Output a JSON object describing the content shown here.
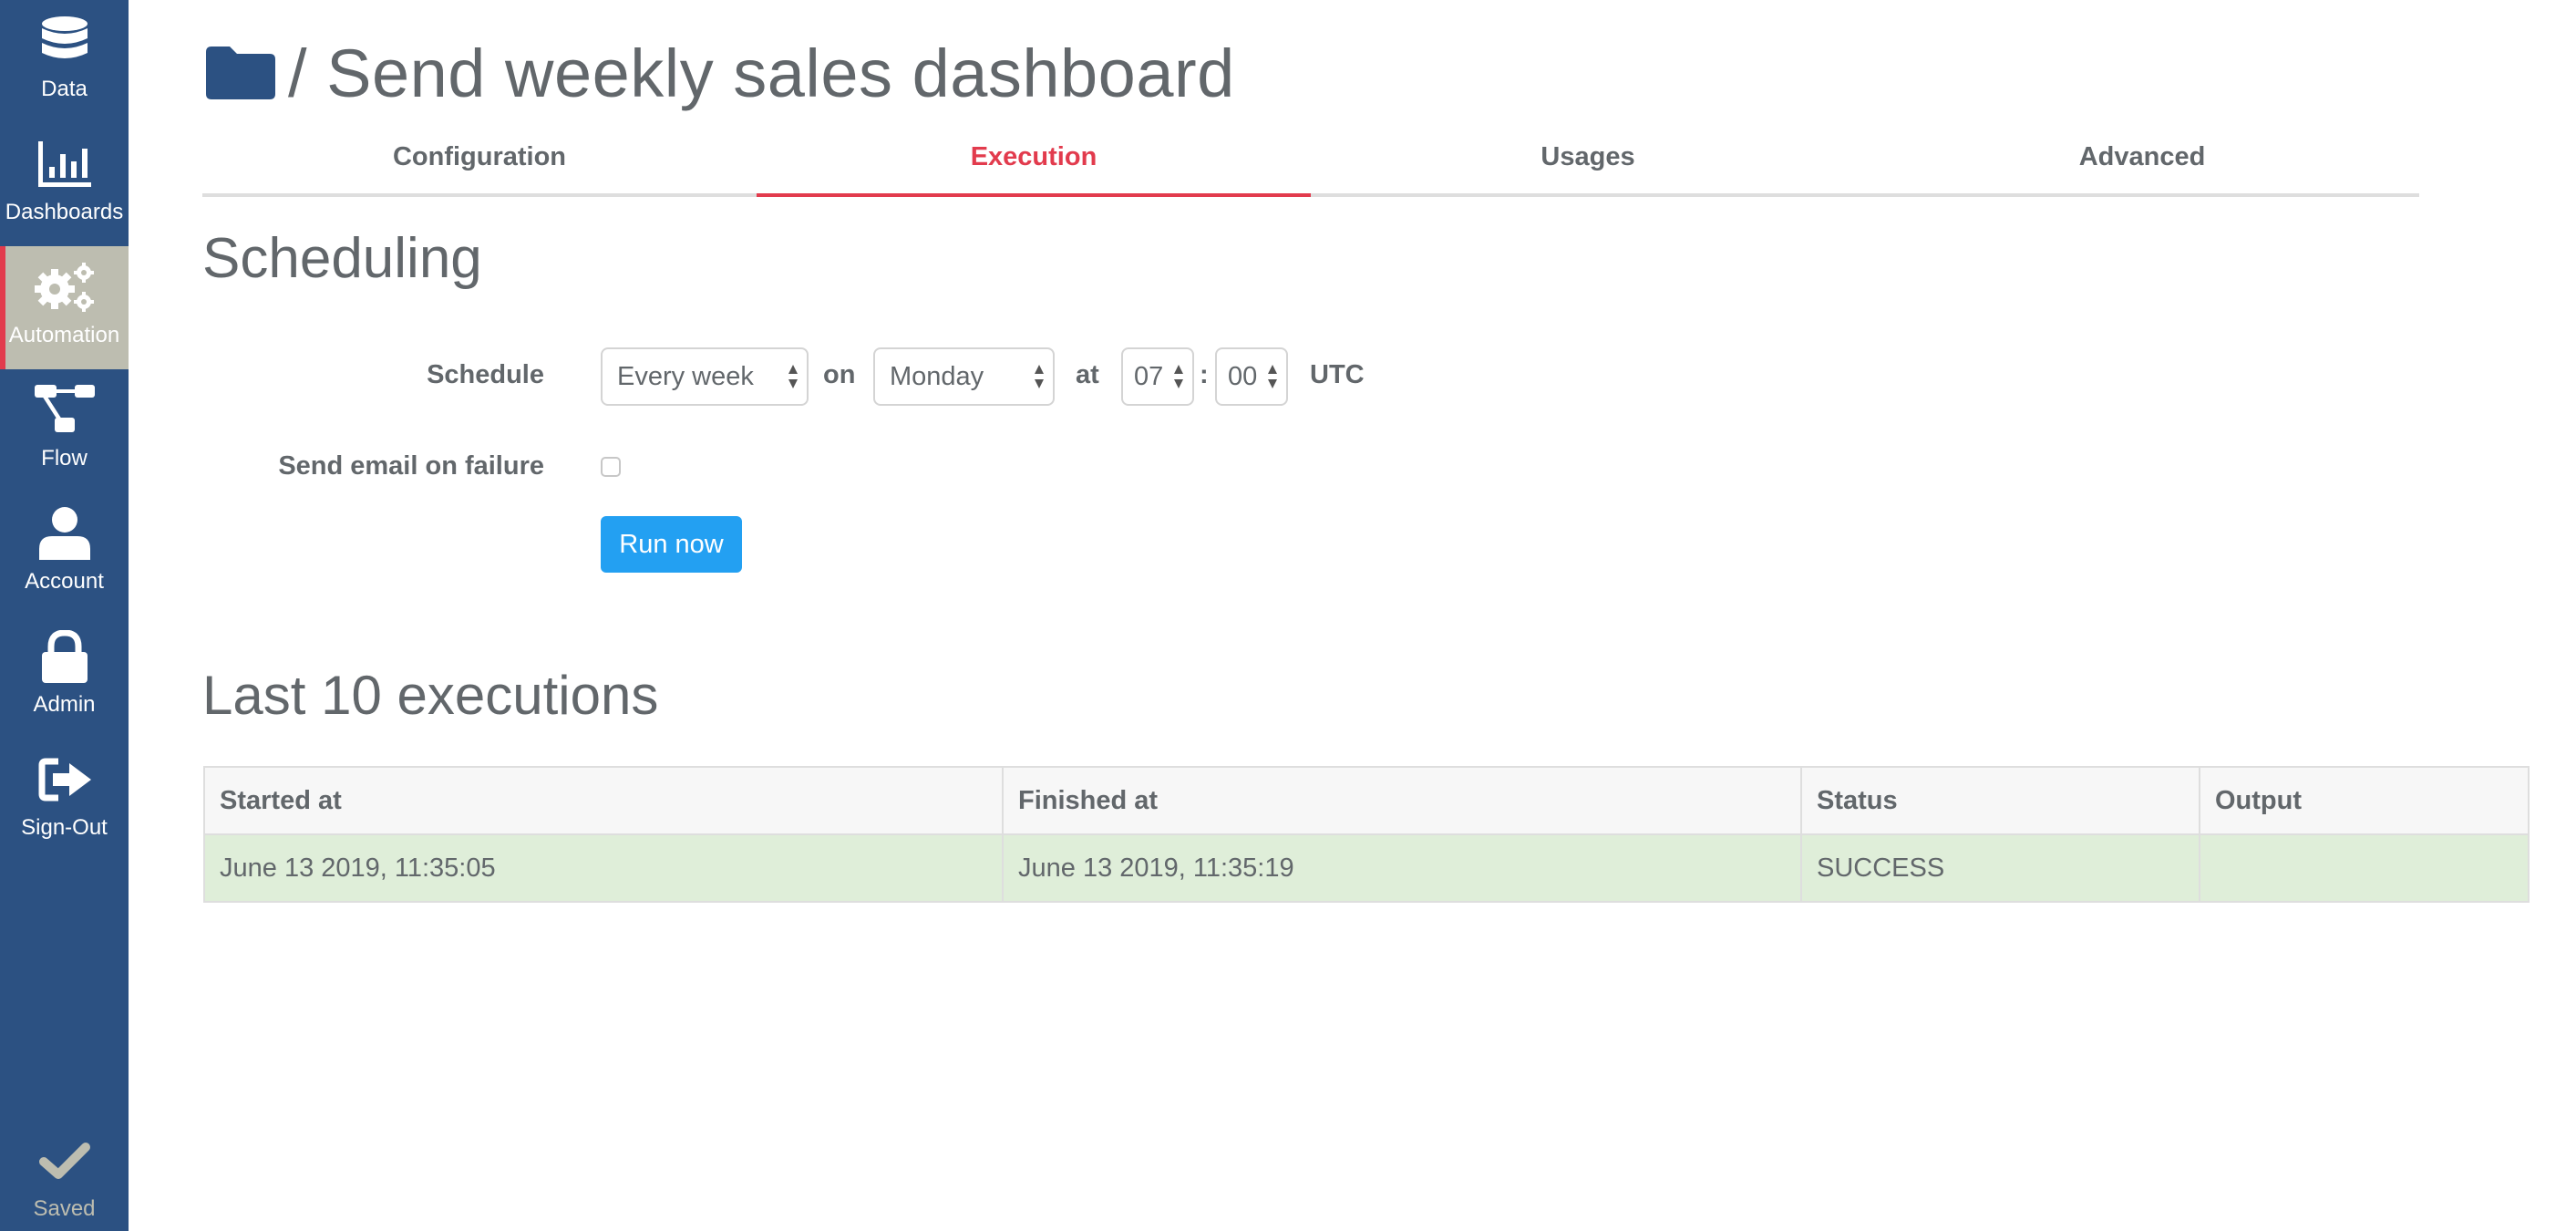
{
  "sidebar": {
    "items": [
      {
        "label": "Data",
        "icon": "database-icon",
        "active": false
      },
      {
        "label": "Dashboards",
        "icon": "bar-chart-icon",
        "active": false
      },
      {
        "label": "Automation",
        "icon": "gears-icon",
        "active": true
      },
      {
        "label": "Flow",
        "icon": "flow-icon",
        "active": false
      },
      {
        "label": "Account",
        "icon": "user-icon",
        "active": false
      },
      {
        "label": "Admin",
        "icon": "lock-icon",
        "active": false
      },
      {
        "label": "Sign-Out",
        "icon": "sign-out-icon",
        "active": false
      }
    ],
    "status": {
      "label": "Saved",
      "icon": "check-icon"
    }
  },
  "header": {
    "breadcrumb_icon": "folder-icon",
    "title": "/ Send weekly sales dashboard"
  },
  "tabs": [
    {
      "label": "Configuration",
      "active": false
    },
    {
      "label": "Execution",
      "active": true
    },
    {
      "label": "Usages",
      "active": false
    },
    {
      "label": "Advanced",
      "active": false
    }
  ],
  "scheduling": {
    "heading": "Scheduling",
    "schedule_label": "Schedule",
    "frequency": "Every week",
    "on_label": "on",
    "day": "Monday",
    "at_label": "at",
    "hour": "07",
    "time_separator": ":",
    "minute": "00",
    "timezone": "UTC",
    "email_label": "Send email on failure",
    "email_checked": false,
    "run_button": "Run now"
  },
  "executions": {
    "heading": "Last 10 executions",
    "columns": [
      "Started at",
      "Finished at",
      "Status",
      "Output"
    ],
    "rows": [
      {
        "started": "June 13 2019, 11:35:05",
        "finished": "June 13 2019, 11:35:19",
        "status": "SUCCESS",
        "output": ""
      }
    ]
  },
  "colors": {
    "sidebar": "#2c5182",
    "active_nav": "#bdbdb0",
    "accent_red": "#e23b4d",
    "button_blue": "#23a0f2",
    "success_row": "#dfeed9"
  }
}
